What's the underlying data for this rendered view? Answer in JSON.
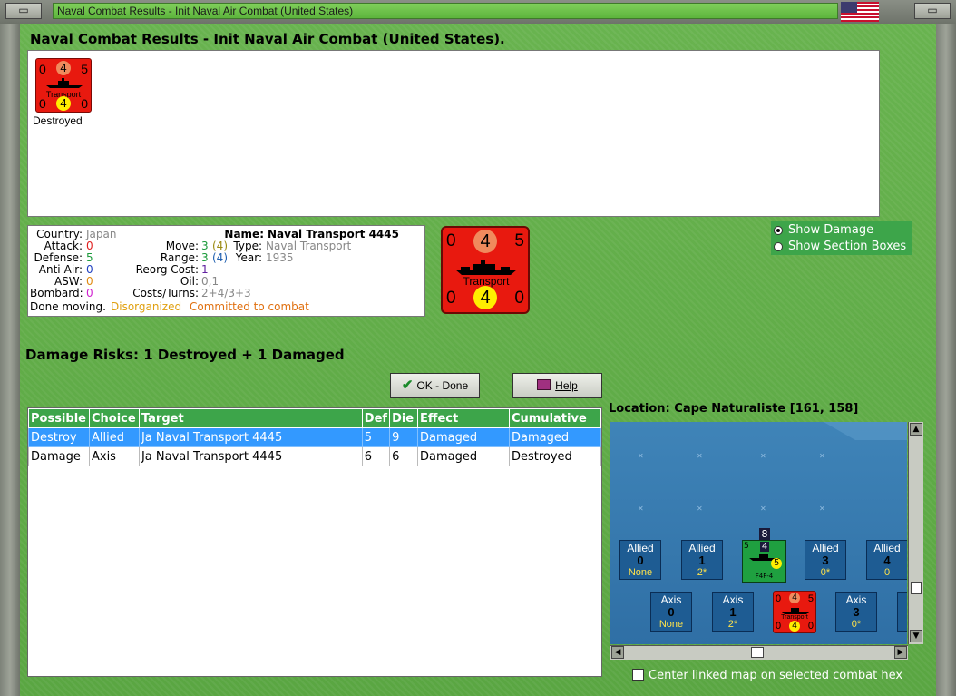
{
  "window": {
    "title": "Naval Combat Results - Init Naval Air Combat (United States)",
    "left_button": "▭",
    "right_button": "▭"
  },
  "page_title": "Naval Combat Results - Init Naval Air Combat (United States).",
  "unit_list": {
    "items": [
      {
        "status": "Destroyed",
        "counter": {
          "tl": "0",
          "tc": "4",
          "tr": "5",
          "label": "Transport",
          "bl": "0",
          "bc": "4",
          "br": "0"
        }
      }
    ]
  },
  "info": {
    "country_label": "Country:",
    "country": "Japan",
    "attack_label": "Attack:",
    "attack": "0",
    "defense_label": "Defense:",
    "defense": "5",
    "antiair_label": "Anti-Air:",
    "antiair": "0",
    "asw_label": "ASW:",
    "asw": "0",
    "bombard_label": "Bombard:",
    "bombard": "0",
    "name_label": "Name:",
    "name": "Naval Transport 4445",
    "move_label": "Move:",
    "move": "3",
    "move_paren": "(4)",
    "range_label": "Range:",
    "range": "3",
    "range_paren": "(4)",
    "type_label": "Type:",
    "type": "Naval Transport",
    "year_label": "Year:",
    "year": "1935",
    "reorg_label": "Reorg Cost:",
    "reorg": "1",
    "oil_label": "Oil:",
    "oil": "0,1",
    "costs_label": "Costs/Turns:",
    "costs": "2+4/3+3",
    "status_done": "Done moving.",
    "status_disorg": "Disorganized",
    "status_committed": "Committed to combat"
  },
  "big_counter": {
    "tl": "0",
    "tc": "4",
    "tr": "5",
    "label": "Transport",
    "bl": "0",
    "bc": "4",
    "br": "0"
  },
  "options": {
    "show_damage": "Show Damage",
    "show_sections": "Show Section Boxes"
  },
  "damage_risks": "Damage Risks:  1 Destroyed + 1 Damaged",
  "buttons": {
    "ok": "OK - Done",
    "help": "Help"
  },
  "table": {
    "headers": [
      "Possible",
      "Choice",
      "Target",
      "Def",
      "Die",
      "Effect",
      "Cumulative"
    ],
    "rows": [
      [
        "Destroy",
        "Allied",
        "Ja Naval Transport 4445",
        "5",
        "9",
        "Damaged",
        "Damaged"
      ],
      [
        "Damage",
        "Axis",
        "Ja Naval Transport 4445",
        "6",
        "6",
        "Damaged",
        "Destroyed"
      ]
    ]
  },
  "location": "Location:  Cape Naturaliste [161, 158]",
  "map": {
    "allied_boxes": [
      {
        "title": "Allied",
        "num": "0",
        "sub": "None"
      },
      {
        "title": "Allied",
        "num": "1",
        "sub": "2*"
      },
      {
        "title": "Allied",
        "num": "3",
        "sub": "0*"
      },
      {
        "title": "Allied",
        "num": "4",
        "sub": "0"
      }
    ],
    "axis_boxes": [
      {
        "title": "Axis",
        "num": "0",
        "sub": "None"
      },
      {
        "title": "Axis",
        "num": "1",
        "sub": "2*"
      },
      {
        "title": "Axis",
        "num": "3",
        "sub": "0*"
      }
    ],
    "carrier_counter": {
      "top": "8",
      "mid": "4",
      "circle": "5",
      "left": "5",
      "label": "F4F-4"
    },
    "transport_counter": {
      "tl": "0",
      "tc": "4",
      "tr": "5",
      "label": "Transport",
      "bl": "0",
      "bc": "4",
      "br": "0"
    }
  },
  "center_check": "Center linked map on selected combat hex",
  "colors": {
    "accent_green": "#3da54a",
    "selection_blue": "#3399ff",
    "counter_red": "#e8190f"
  }
}
